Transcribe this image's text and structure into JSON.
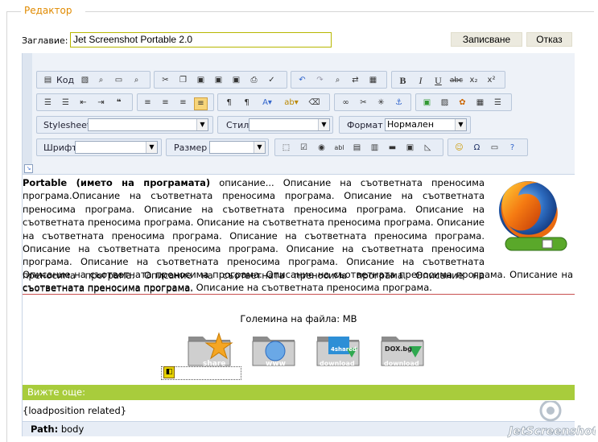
{
  "fieldset": {
    "legend": "Редактор"
  },
  "form": {
    "title_label": "Заглавие:",
    "title_value": "Jet Screenshot Portable 2.0",
    "save_label": "Записване",
    "cancel_label": "Отказ"
  },
  "toolbar": {
    "code_label": "Код",
    "stylesheet_label": "Stylesheet",
    "style_label": "Стил",
    "format_label": "Формат",
    "format_value": "Нормален",
    "font_label": "Шрифт",
    "size_label": "Размер"
  },
  "content": {
    "bold_lead": "Portable (името на програмата)",
    "paragraph_rest": " описание... Описание на съответната преносима програма.Описание на съответната преносима програма. Описание на съответната преносима програма. Описание на съответната преносима програма. Описание на съответната преносима програма. Описание на съответната преносима програма. Описание на съответната преносима програма. Описание на съответната преносима програма. Описание на съответната преносима програма. Описание на съответната преносима програма. Описание на съответната преносима програма. Описание на съответната преносима програма. Описание на съответната преносима програма. Описание на съответната преносима програма.",
    "paragraph_tail": "Описание на съответната преносима програма. Описание на съответната преносима програма. Описание на съответната преносима програма. Описание на съответната преносима програма.",
    "file_size_label": "Големина на файла:  MB",
    "downloads": [
      {
        "label": "share"
      },
      {
        "label": "www"
      },
      {
        "label": "download",
        "badge": "4shared"
      },
      {
        "label": "download",
        "badge": "DOX.bg"
      }
    ],
    "see_more": "Вижте още:",
    "loadposition": "{loadposition related}"
  },
  "status": {
    "path_label": "Path:",
    "path_value": "body"
  },
  "watermark": {
    "text": "JetScreenshot"
  },
  "colors": {
    "accent_orange": "#e08a00",
    "green_bar": "#a8cc3c",
    "toolbar_bg": "#eef2f8"
  }
}
